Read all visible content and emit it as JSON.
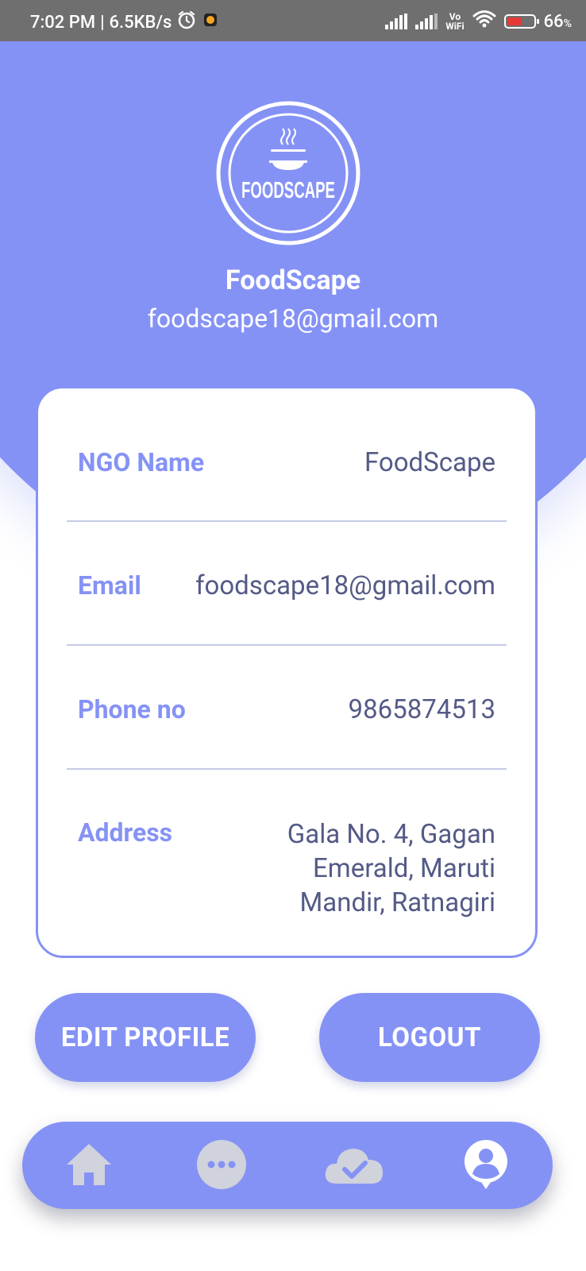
{
  "status_bar": {
    "time": "7:02 PM",
    "speed": "6.5KB/s",
    "vowifi_top": "Vo",
    "vowifi_bottom": "WiFi",
    "battery_pct": "66",
    "battery_unit": "%",
    "icons": [
      "alarm-icon",
      "notification-icon",
      "signal-icon",
      "signal-icon",
      "vowifi-icon",
      "wifi-icon",
      "battery-charging-icon"
    ]
  },
  "header": {
    "logo_text": "FOODSCAPE",
    "name": "FoodScape",
    "email": "foodscape18@gmail.com"
  },
  "details": [
    {
      "label": "NGO Name",
      "value": "FoodScape"
    },
    {
      "label": "Email",
      "value": "foodscape18@gmail.com"
    },
    {
      "label": "Phone no",
      "value": "9865874513"
    },
    {
      "label": "Address",
      "value": "Gala No. 4, Gagan Emerald, Maruti Mandir, Ratnagiri"
    }
  ],
  "buttons": {
    "edit_profile": "EDIT PROFILE",
    "logout": "LOGOUT"
  },
  "nav": {
    "items": [
      "home-icon",
      "chat-icon",
      "cloud-check-icon",
      "profile-icon"
    ],
    "active": "profile-icon"
  },
  "colors": {
    "primary": "#8592f5",
    "label": "#8592f5",
    "value": "#545a86",
    "inactive_icon": "#d0d2dc",
    "active_icon": "#ffffff"
  }
}
